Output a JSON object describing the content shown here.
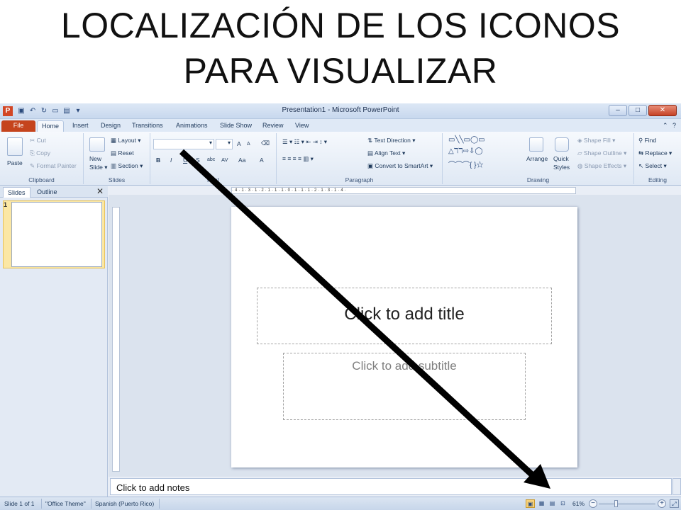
{
  "heading": {
    "line1": "LOCALIZACIÓN DE LOS ICONOS",
    "line2": "PARA VISUALIZAR"
  },
  "window": {
    "title": "Presentation1 - Microsoft PowerPoint",
    "app_logo": "P",
    "controls": {
      "minimize": "–",
      "maximize": "□",
      "close": "✕"
    }
  },
  "tabs": [
    "File",
    "Home",
    "Insert",
    "Design",
    "Transitions",
    "Animations",
    "Slide Show",
    "Review",
    "View"
  ],
  "ribbon": {
    "clipboard": {
      "paste": "Paste",
      "cut": "Cut",
      "copy": "Copy",
      "format_painter": "Format Painter",
      "label": "Clipboard"
    },
    "slides": {
      "new_slide_line1": "New",
      "new_slide_line2": "Slide",
      "layout": "Layout",
      "reset": "Reset",
      "section": "Section",
      "label": "Slides"
    },
    "font": {
      "label": "Font",
      "bold": "B",
      "italic": "I",
      "underline": "U",
      "strike": "S",
      "size_up": "A",
      "size_down": "A",
      "abc": "abc",
      "spacing": "AV",
      "case": "Aa",
      "color": "A"
    },
    "paragraph": {
      "text_direction": "Text Direction",
      "align_text": "Align Text",
      "convert": "Convert to SmartArt",
      "label": "Paragraph"
    },
    "drawing": {
      "arrange": "Arrange",
      "quick_styles_line1": "Quick",
      "quick_styles_line2": "Styles",
      "shape_fill": "Shape Fill",
      "shape_outline": "Shape Outline",
      "shape_effects": "Shape Effects",
      "label": "Drawing"
    },
    "editing": {
      "find": "Find",
      "replace": "Replace",
      "select": "Select",
      "label": "Editing"
    }
  },
  "panel": {
    "tab_slides": "Slides",
    "tab_outline": "Outline",
    "close": "✕",
    "thumb_number": "1"
  },
  "ruler": {
    "horizontal": "·4·1·3·1·2·1·1·1·0·1·1·1·2·1·3·1·4·"
  },
  "slide": {
    "title_placeholder": "Click to add title",
    "subtitle_placeholder": "Click to add subtitle"
  },
  "notes": {
    "placeholder": "Click to add notes"
  },
  "status": {
    "slide": "Slide 1 of 1",
    "theme": "\"Office Theme\"",
    "language": "Spanish (Puerto Rico)",
    "zoom": "61%"
  },
  "colors": {
    "arrow": "#000000",
    "file_tab": "#c5441d",
    "selected_thumb": "#fbe7a4"
  }
}
